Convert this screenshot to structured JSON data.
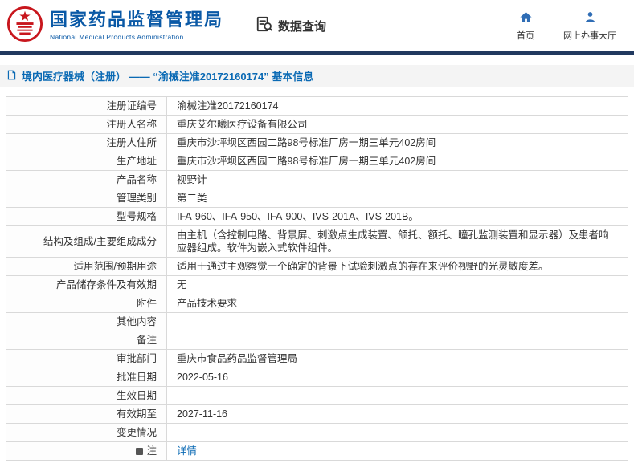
{
  "header": {
    "agency_cn": "国家药品监督管理局",
    "agency_en": "National Medical Products Administration",
    "query_title": "数据查询",
    "nav": {
      "home": "首页",
      "service_hall": "网上办事大厅"
    }
  },
  "breadcrumb": {
    "text": "境内医疗器械（注册） —— “渝械注准20172160174” 基本信息"
  },
  "colors": {
    "brand_blue": "#0a59a6",
    "divider_navy": "#21395f",
    "link_blue": "#0b6ab4",
    "emblem_red": "#c8161d"
  },
  "table": {
    "rows": [
      {
        "label": "注册证编号",
        "value": "渝械注准20172160174"
      },
      {
        "label": "注册人名称",
        "value": "重庆艾尔曦医疗设备有限公司"
      },
      {
        "label": "注册人住所",
        "value": "重庆市沙坪坝区西园二路98号标准厂房一期三单元402房间"
      },
      {
        "label": "生产地址",
        "value": "重庆市沙坪坝区西园二路98号标准厂房一期三单元402房间"
      },
      {
        "label": "产品名称",
        "value": "视野计"
      },
      {
        "label": "管理类别",
        "value": "第二类"
      },
      {
        "label": "型号规格",
        "value": "IFA-960、IFA-950、IFA-900、IVS-201A、IVS-201B。"
      },
      {
        "label": "结构及组成/主要组成成分",
        "value": "由主机（含控制电路、背景屏、刺激点生成装置、颌托、额托、瞳孔监测装置和显示器）及患者响应器组成。软件为嵌入式软件组件。"
      },
      {
        "label": "适用范围/预期用途",
        "value": "适用于通过主观察觉一个确定的背景下试验刺激点的存在来评价视野的光灵敏度差。"
      },
      {
        "label": "产品储存条件及有效期",
        "value": "无"
      },
      {
        "label": "附件",
        "value": "产品技术要求"
      },
      {
        "label": "其他内容",
        "value": ""
      },
      {
        "label": "备注",
        "value": ""
      },
      {
        "label": "审批部门",
        "value": "重庆市食品药品监督管理局"
      },
      {
        "label": "批准日期",
        "value": "2022-05-16"
      },
      {
        "label": "生效日期",
        "value": ""
      },
      {
        "label": "有效期至",
        "value": "2027-11-16"
      },
      {
        "label": "变更情况",
        "value": ""
      },
      {
        "label": "注",
        "value": "详情"
      }
    ]
  }
}
